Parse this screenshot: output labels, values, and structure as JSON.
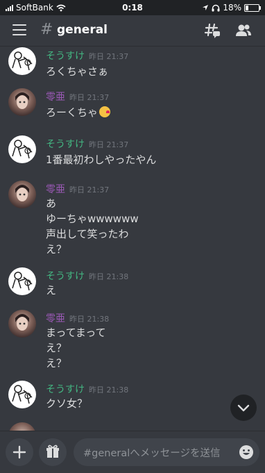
{
  "status_bar": {
    "carrier": "SoftBank",
    "time": "0:18",
    "battery": "18%",
    "battery_level": 0.18
  },
  "header": {
    "channel_name": "general"
  },
  "messages": [
    {
      "author": "そうすけ",
      "time": "昨日 21:37",
      "lines": [
        "ろくちゃさぁ"
      ]
    },
    {
      "author": "零亜",
      "time": "昨日 21:37",
      "lines": [
        "ろーくちゃ"
      ]
    },
    {
      "author": "そうすけ",
      "time": "昨日 21:37",
      "lines": [
        "1番最初わしやったやん"
      ]
    },
    {
      "author": "零亜",
      "time": "昨日 21:37",
      "lines": [
        "あ",
        "ゆーちゃwwwwww",
        "声出して笑ったわ",
        "え？"
      ]
    },
    {
      "author": "そうすけ",
      "time": "昨日 21:38",
      "lines": [
        "え"
      ]
    },
    {
      "author": "零亜",
      "time": "昨日 21:38",
      "lines": [
        "まってまって",
        "え？",
        "え？"
      ]
    },
    {
      "author": "そうすけ",
      "time": "昨日 21:38",
      "lines": [
        "クソ女？"
      ]
    }
  ],
  "composer": {
    "placeholder": "#generalへメッセージを送信"
  },
  "colors": {
    "background": "#36393f",
    "author_green": "#43b581",
    "author_purple": "#9b59b6"
  },
  "icons": [
    "signal-icon",
    "wifi-icon",
    "location-icon",
    "headphones-icon",
    "battery-icon",
    "menu-icon",
    "hash-icon",
    "threads-icon",
    "members-icon",
    "kissing-emoji-icon",
    "chevron-down-icon",
    "plus-icon",
    "gift-icon",
    "emoji-icon"
  ]
}
